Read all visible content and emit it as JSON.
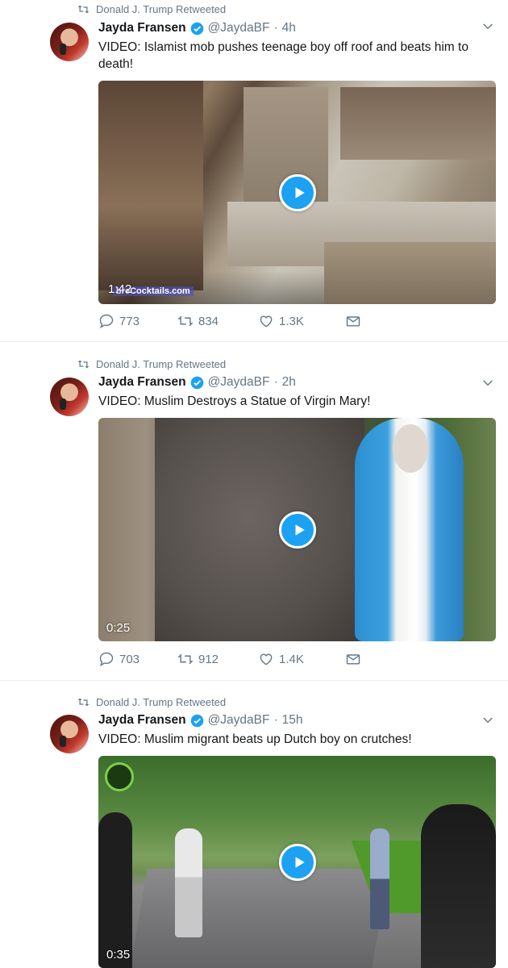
{
  "tweets": [
    {
      "retweeted_by": "Donald J. Trump Retweeted",
      "name": "Jayda Fransen",
      "handle": "@JaydaBF",
      "time": "4h",
      "text": "VIDEO: Islamist mob pushes teenage boy off roof and beats him to death!",
      "video_duration": "1:42",
      "watermark": "breCocktails.com",
      "replies": "773",
      "retweets": "834",
      "likes": "1.3K"
    },
    {
      "retweeted_by": "Donald J. Trump Retweeted",
      "name": "Jayda Fransen",
      "handle": "@JaydaBF",
      "time": "2h",
      "text": "VIDEO: Muslim Destroys a Statue of Virgin Mary!",
      "video_duration": "0:25",
      "replies": "703",
      "retweets": "912",
      "likes": "1.4K"
    },
    {
      "retweeted_by": "Donald J. Trump Retweeted",
      "name": "Jayda Fransen",
      "handle": "@JaydaBF",
      "time": "15h",
      "text": "VIDEO: Muslim migrant beats up Dutch boy on crutches!",
      "video_duration": "0:35"
    }
  ],
  "dot": "·",
  "colors": {
    "accent": "#1da1f2",
    "muted": "#657786",
    "text": "#14171a"
  },
  "icons": [
    "retweet-icon",
    "verified-badge-icon",
    "chevron-down-icon",
    "play-icon",
    "reply-icon",
    "heart-icon",
    "direct-message-icon"
  ]
}
